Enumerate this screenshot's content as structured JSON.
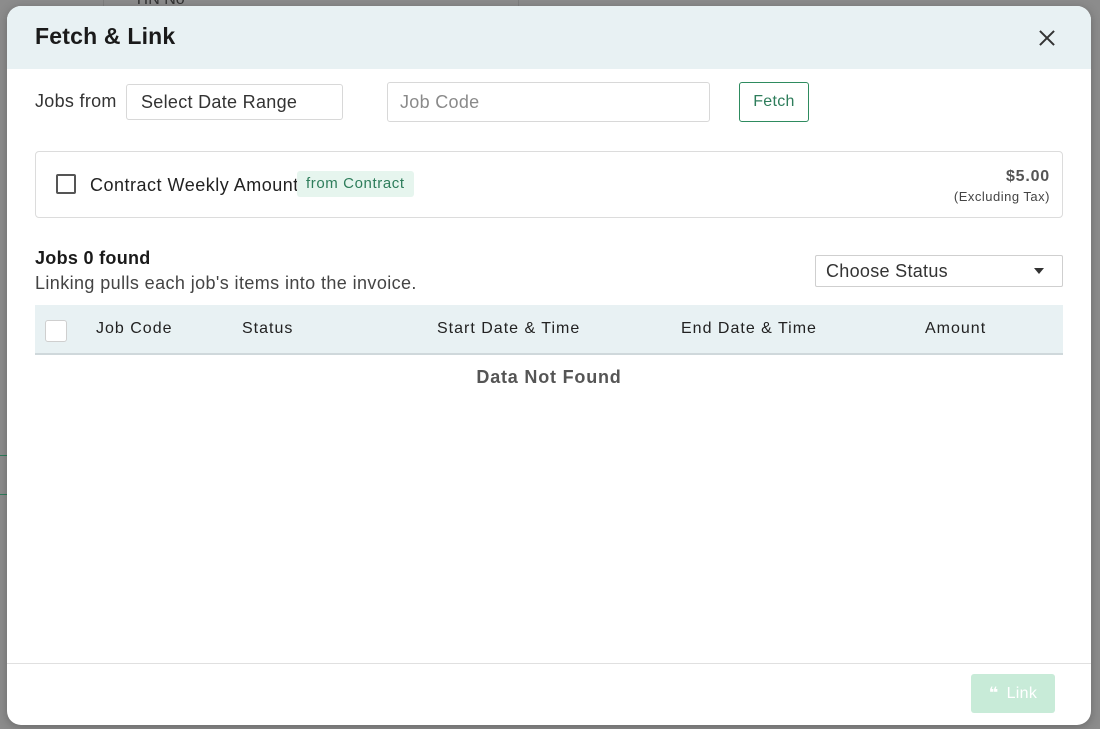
{
  "background": {
    "partial_text": "TIN No"
  },
  "modal": {
    "title": "Fetch & Link",
    "close_icon": "close-icon"
  },
  "filters": {
    "jobs_from_label": "Jobs from",
    "date_range_value": "Select Date Range",
    "job_code_placeholder": "Job Code",
    "job_code_value": "",
    "fetch_label": "Fetch"
  },
  "contract": {
    "checked": false,
    "label": "Contract Weekly Amount",
    "badge": "from Contract",
    "amount": "$5.00",
    "amount_note": "(Excluding Tax)"
  },
  "jobs": {
    "found_text": "Jobs 0 found",
    "note": "Linking pulls each job's items into the invoice.",
    "status_select_value": "Choose Status",
    "table": {
      "columns": [
        "Job Code",
        "Status",
        "Start Date & Time",
        "End Date & Time",
        "Amount"
      ],
      "rows": [],
      "empty_message": "Data Not Found"
    }
  },
  "footer": {
    "link_label": "Link",
    "link_icon": "link-icon"
  },
  "colors": {
    "accent": "#2e7d5b",
    "header_bg": "#e8f1f3",
    "badge_bg": "#e6f5ee",
    "link_disabled_bg": "#c8ebd8"
  }
}
